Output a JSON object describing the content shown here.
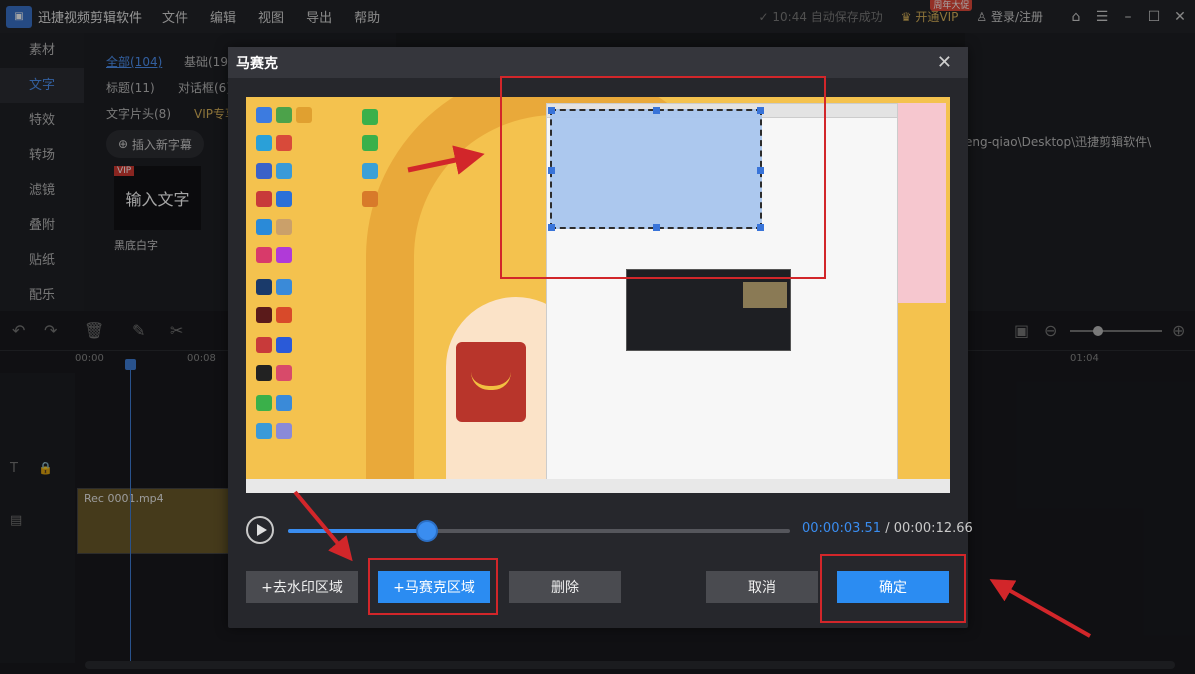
{
  "app": {
    "name": "迅捷视频剪辑软件",
    "menu": [
      "文件",
      "编辑",
      "视图",
      "导出",
      "帮助"
    ],
    "autosave": "10:44 自动保存成功",
    "vip_label": "开通VIP",
    "vip_badge": "周年大促",
    "login": "登录/注册"
  },
  "left_nav": [
    "素材",
    "文字",
    "特效",
    "转场",
    "滤镜",
    "叠附",
    "贴纸",
    "配乐"
  ],
  "text_panel": {
    "tabs": [
      "全部(104)",
      "基础(19)",
      "标题(11)",
      "对话框(6)",
      "文字片头(8)",
      "VIP专享"
    ],
    "insert_button": "插入新字幕",
    "card_text": "输入文字",
    "card_label": "黑底白字",
    "vip_mark": "VIP"
  },
  "right_panel": {
    "path": "eng-qiao\\Desktop\\迅捷剪辑软件\\"
  },
  "timeline": {
    "ruler": [
      "00:00",
      "00:08"
    ],
    "right_time": "01:04",
    "clip_label": "Rec 0001.mp4"
  },
  "dialog": {
    "title": "马赛克",
    "close": "✕",
    "current_time": "00:00:03.51",
    "separator": " / ",
    "total_time": "00:00:12.66",
    "progress": 0.277,
    "buttons": {
      "remove_watermark": "+去水印区域",
      "add_mosaic": "+马赛克区域",
      "delete": "删除",
      "cancel": "取消",
      "confirm": "确定"
    }
  },
  "colors": {
    "accent": "#2b8cf2",
    "annotation_red": "#d2262a"
  }
}
